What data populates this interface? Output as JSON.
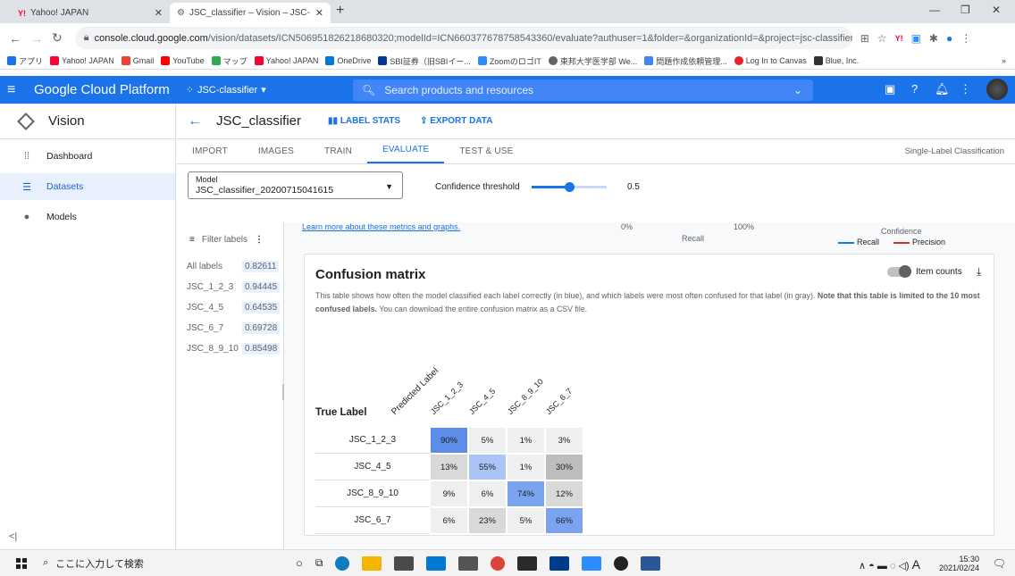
{
  "browser": {
    "tabs": [
      {
        "title": "Yahoo! JAPAN",
        "icon": "yahoo-icon"
      },
      {
        "title": "JSC_classifier – Vision – JSC-class",
        "icon": "gcp-icon"
      }
    ],
    "url_host": "console.cloud.google.com",
    "url_rest": "/vision/datasets/ICN506951826218680320;modelId=ICN660377678758543360/evaluate?authuser=1&folder=&organizationId=&project=jsc-classifier&suppo...",
    "bookmarks": [
      "アプリ",
      "Yahoo! JAPAN",
      "Gmail",
      "YouTube",
      "マップ",
      "Yahoo! JAPAN",
      "OneDrive",
      "SBI証券（旧SBIイー...",
      "ZoomのロゴIT",
      "東邦大学医学部 We...",
      "問題作成依頼管理...",
      "Log In to Canvas",
      "Blue, Inc."
    ],
    "bookmarks_more": "»"
  },
  "gcp": {
    "brand": "Google Cloud Platform",
    "project": "JSC-classifier",
    "search_placeholder": "Search products and resources"
  },
  "leftnav": {
    "product": "Vision",
    "items": [
      {
        "label": "Dashboard",
        "icon": "dashboard-icon",
        "active": false
      },
      {
        "label": "Datasets",
        "icon": "datasets-icon",
        "active": true
      },
      {
        "label": "Models",
        "icon": "models-icon",
        "active": false
      }
    ]
  },
  "page": {
    "title": "JSC_classifier",
    "actions": [
      "LABEL STATS",
      "EXPORT DATA"
    ],
    "tabs": [
      "IMPORT",
      "IMAGES",
      "TRAIN",
      "EVALUATE",
      "TEST & USE"
    ],
    "active_tab": "EVALUATE",
    "classification_type": "Single-Label Classification",
    "model_label": "Model",
    "model_value": "JSC_classifier_20200715041615",
    "confidence_label": "Confidence threshold",
    "confidence_value": "0.5",
    "confidence_level": 0.5
  },
  "labels_panel": {
    "filter_placeholder": "Filter labels",
    "rows": [
      {
        "name": "All labels",
        "value": "0.82611"
      },
      {
        "name": "JSC_1_2_3",
        "value": "0.94445"
      },
      {
        "name": "JSC_4_5",
        "value": "0.64535"
      },
      {
        "name": "JSC_6_7",
        "value": "0.69728"
      },
      {
        "name": "JSC_8_9_10",
        "value": "0.85498"
      }
    ]
  },
  "metrics_strip": {
    "link": "Learn more about these metrics and graphs.",
    "x_min": "0%",
    "x_max": "100%",
    "recall": "Recall",
    "confidence": "Confidence",
    "legend_recall": "Recall",
    "legend_precision": "Precision"
  },
  "confusion": {
    "title": "Confusion matrix",
    "desc_1": "This table shows how often the model classified each label correctly (in blue), and which labels were most often confused for that label (in gray).",
    "desc_bold": "Note that this table is limited to the 10 most confused labels.",
    "desc_2": "You can download the entire confusion matrix as a CSV file.",
    "item_counts": "Item counts",
    "predicted_label": "Predicted Label",
    "true_label": "True Label",
    "columns": [
      "JSC_1_2_3",
      "JSC_4_5",
      "JSC_8_9_10",
      "JSC_6_7"
    ],
    "rows": [
      {
        "label": "JSC_1_2_3",
        "cells": [
          "90%",
          "5%",
          "1%",
          "3%"
        ]
      },
      {
        "label": "JSC_4_5",
        "cells": [
          "13%",
          "55%",
          "1%",
          "30%"
        ]
      },
      {
        "label": "JSC_8_9_10",
        "cells": [
          "9%",
          "6%",
          "74%",
          "12%"
        ]
      },
      {
        "label": "JSC_6_7",
        "cells": [
          "6%",
          "23%",
          "5%",
          "66%"
        ]
      }
    ]
  },
  "taskbar": {
    "search_placeholder": "ここに入力して検索",
    "time": "15:30",
    "date": "2021/02/24",
    "ime": "A"
  },
  "colors": {
    "accent": "#1a73e8",
    "diag_blue": "#5c8de8",
    "diag_blue_mid": "#7aa3f0",
    "gray_dark": "#bdbdbd",
    "gray_mid": "#d9d9d9",
    "gray_light": "#efefef"
  }
}
